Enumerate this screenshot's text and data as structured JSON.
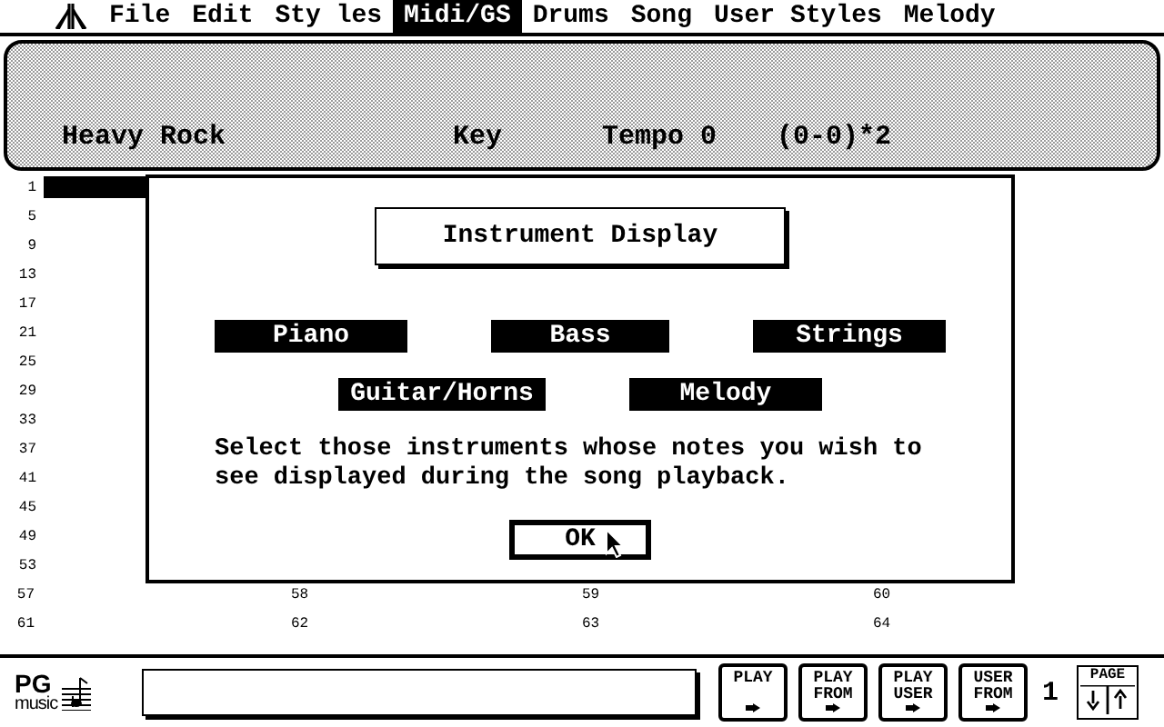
{
  "menu": [
    {
      "label": "File",
      "selected": false
    },
    {
      "label": "Edit",
      "selected": false
    },
    {
      "label": "Sty les",
      "selected": false
    },
    {
      "label": "Midi/GS",
      "selected": true
    },
    {
      "label": "Drums",
      "selected": false
    },
    {
      "label": "Song",
      "selected": false
    },
    {
      "label": "User Styles",
      "selected": false
    },
    {
      "label": "Melody",
      "selected": false
    }
  ],
  "info": {
    "style": "Heavy Rock",
    "key": "Key",
    "tempo": "Tempo 0",
    "form": "(0-0)*2"
  },
  "rows": [
    {
      "label": "1",
      "selected": true,
      "cells": []
    },
    {
      "label": "5",
      "selected": false,
      "cells": []
    },
    {
      "label": "9",
      "selected": false,
      "cells": []
    },
    {
      "label": "13",
      "selected": false,
      "cells": []
    },
    {
      "label": "17",
      "selected": false,
      "cells": []
    },
    {
      "label": "21",
      "selected": false,
      "cells": []
    },
    {
      "label": "25",
      "selected": false,
      "cells": []
    },
    {
      "label": "29",
      "selected": false,
      "cells": []
    },
    {
      "label": "33",
      "selected": false,
      "cells": []
    },
    {
      "label": "37",
      "selected": false,
      "cells": []
    },
    {
      "label": "41",
      "selected": false,
      "cells": []
    },
    {
      "label": "45",
      "selected": false,
      "cells": []
    },
    {
      "label": "49",
      "selected": false,
      "cells": []
    },
    {
      "label": "53",
      "selected": false,
      "cells": []
    },
    {
      "label": "57",
      "selected": false,
      "cells": [
        "58",
        "59",
        "60"
      ]
    },
    {
      "label": "61",
      "selected": false,
      "cells": [
        "62",
        "63",
        "64"
      ]
    }
  ],
  "dialog": {
    "title": "Instrument Display",
    "options": [
      [
        {
          "label": "Piano",
          "selected": true
        },
        {
          "label": "Bass",
          "selected": true
        },
        {
          "label": "Strings",
          "selected": true
        }
      ],
      [
        {
          "label": "Guitar/Horns",
          "selected": true
        },
        {
          "label": "Melody",
          "selected": true
        }
      ]
    ],
    "message": "Select those instruments whose notes you wish to see displayed during the song playback.",
    "ok": "OK"
  },
  "footer": {
    "logo_top": "PG",
    "logo_bottom": "music",
    "buttons": [
      [
        "PLAY"
      ],
      [
        "PLAY",
        "FROM"
      ],
      [
        "PLAY",
        "USER"
      ],
      [
        "USER",
        "FROM"
      ]
    ],
    "page_number": "1",
    "page_label": "PAGE"
  }
}
